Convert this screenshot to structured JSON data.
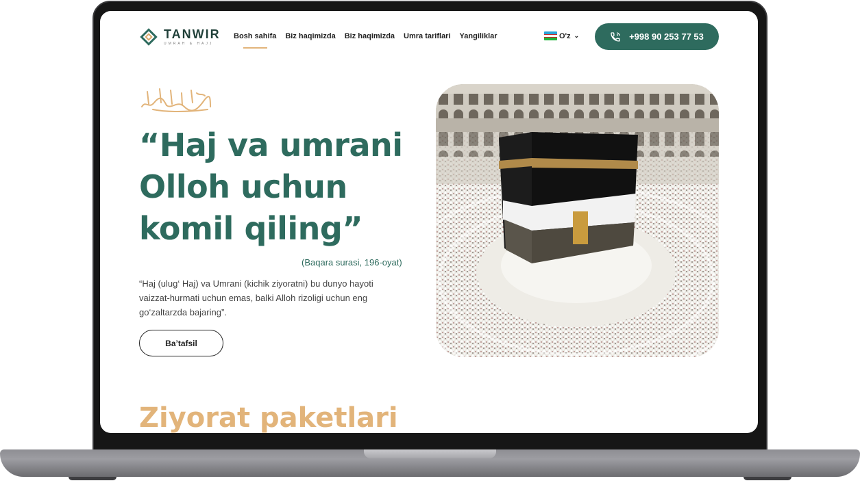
{
  "header": {
    "logo": {
      "title": "TANWIR",
      "subtitle": "UMRAH & HAJJ"
    },
    "nav": [
      {
        "label": "Bosh sahifa",
        "active": true
      },
      {
        "label": "Biz haqimizda",
        "active": false
      },
      {
        "label": "Biz haqimizda",
        "active": false
      },
      {
        "label": "Umra tariflari",
        "active": false
      },
      {
        "label": "Yangiliklar",
        "active": false
      }
    ],
    "language": {
      "label": "O'z",
      "flag": "uzbekistan-flag"
    },
    "phone": {
      "label": "+998 90 253 77 53",
      "icon": "phone-icon"
    }
  },
  "hero": {
    "title": "“Haj va umrani Olloh uchun komil qiling”",
    "source": "(Baqara surasi, 196-oyat)",
    "description": "“Haj (ulug‘ Haj) va Umrani (kichik ziyoratni) bu dunyo hayoti vaizzat-hurmati uchun emas, balki Alloh rizoligi uchun eng go‘zaltarzda bajaring”.",
    "button_label": "Ba’tafsil"
  },
  "packages": {
    "title": "Ziyorat paketlari"
  },
  "colors": {
    "primary": "#2e6b5e",
    "accent": "#e2b47a",
    "text": "#222222"
  }
}
